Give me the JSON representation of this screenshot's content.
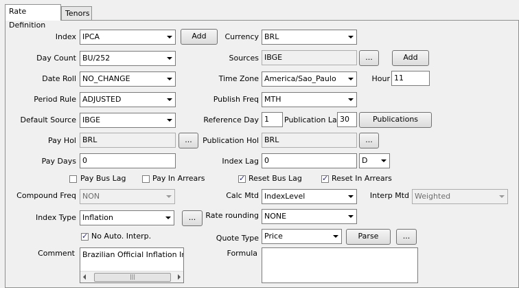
{
  "tabs": [
    {
      "label": "Rate Definition"
    },
    {
      "label": "Tenors"
    }
  ],
  "form": {
    "index": {
      "label": "Index",
      "value": "IPCA",
      "add": "Add"
    },
    "currency": {
      "label": "Currency",
      "value": "BRL"
    },
    "day_count": {
      "label": "Day Count",
      "value": "BU/252"
    },
    "sources": {
      "label": "Sources",
      "value": "IBGE",
      "ellipsis": "...",
      "add": "Add"
    },
    "date_roll": {
      "label": "Date Roll",
      "value": "NO_CHANGE"
    },
    "time_zone": {
      "label": "Time Zone",
      "value": "America/Sao_Paulo"
    },
    "hour": {
      "label": "Hour",
      "value": "11"
    },
    "period_rule": {
      "label": "Period Rule",
      "value": "ADJUSTED"
    },
    "publish_freq": {
      "label": "Publish Freq",
      "value": "MTH"
    },
    "default_source": {
      "label": "Default Source",
      "value": "IBGE"
    },
    "reference_day": {
      "label": "Reference Day",
      "value": "1"
    },
    "publication_lag": {
      "label": "Publication Lag",
      "value": "30"
    },
    "publications_button": "Publications",
    "pay_hol": {
      "label": "Pay Hol",
      "value": "BRL",
      "ellipsis": "..."
    },
    "publication_hol": {
      "label": "Publication Hol",
      "value": "BRL",
      "ellipsis": "..."
    },
    "pay_days": {
      "label": "Pay Days",
      "value": "0"
    },
    "index_lag": {
      "label": "Index Lag",
      "value": "0",
      "unit": "D"
    },
    "checks": {
      "pay_bus_lag": {
        "label": "Pay Bus Lag",
        "checked": false
      },
      "pay_in_arrears": {
        "label": "Pay In Arrears",
        "checked": false
      },
      "reset_bus_lag": {
        "label": "Reset Bus Lag",
        "checked": true
      },
      "reset_in_arrears": {
        "label": "Reset In Arrears",
        "checked": true
      }
    },
    "compound_freq": {
      "label": "Compound Freq",
      "value": "NON"
    },
    "calc_mtd": {
      "label": "Calc Mtd",
      "value": "IndexLevel"
    },
    "interp_mtd": {
      "label": "Interp Mtd",
      "value": "Weighted"
    },
    "index_type": {
      "label": "Index Type",
      "value": "Inflation",
      "ellipsis": "..."
    },
    "rate_rounding": {
      "label": "Rate rounding",
      "value": "NONE"
    },
    "no_auto_interp": {
      "label": "No Auto. Interp.",
      "checked": true
    },
    "quote_type": {
      "label": "Quote Type",
      "value": "Price",
      "parse": "Parse",
      "ellipsis": "..."
    },
    "comment": {
      "label": "Comment",
      "value": "Brazilian Official Inflation Index"
    },
    "formula": {
      "label": "Formula",
      "value": ""
    },
    "scroll": {
      "thumb": "|||"
    }
  }
}
